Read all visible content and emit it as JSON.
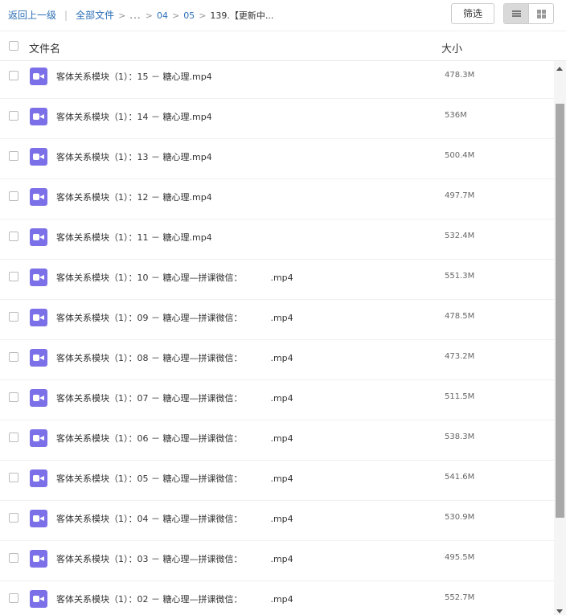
{
  "breadcrumb": {
    "back": "返回上一级",
    "separator": "|",
    "all_files": "全部文件",
    "ellipsis": "...",
    "level1": "04",
    "level2": "05",
    "current": "139.【更新中..."
  },
  "toolbar": {
    "filter_label": "筛选",
    "view_mode": "list"
  },
  "table": {
    "columns": {
      "name": "文件名",
      "size": "大小"
    },
    "rows": [
      {
        "name": "客体关系模块（1）：15 － 糖心理.mp4",
        "size": "478.3M",
        "icon": "video-file-icon"
      },
      {
        "name": "客体关系模块（1）：14 － 糖心理.mp4",
        "size": "536M",
        "icon": "video-file-icon"
      },
      {
        "name": "客体关系模块（1）：13 － 糖心理.mp4",
        "size": "500.4M",
        "icon": "video-file-icon"
      },
      {
        "name": "客体关系模块（1）：12 － 糖心理.mp4",
        "size": "497.7M",
        "icon": "video-file-icon"
      },
      {
        "name": "客体关系模块（1）：11 － 糖心理.mp4",
        "size": "532.4M",
        "icon": "video-file-icon"
      },
      {
        "name": "客体关系模块（1）：10 － 糖心理—拼课微信：          .mp4",
        "size": "551.3M",
        "icon": "video-file-icon"
      },
      {
        "name": "客体关系模块（1）：09 － 糖心理—拼课微信：          .mp4",
        "size": "478.5M",
        "icon": "video-file-icon"
      },
      {
        "name": "客体关系模块（1）：08 － 糖心理—拼课微信：          .mp4",
        "size": "473.2M",
        "icon": "video-file-icon"
      },
      {
        "name": "客体关系模块（1）：07 － 糖心理—拼课微信：          .mp4",
        "size": "511.5M",
        "icon": "video-file-icon"
      },
      {
        "name": "客体关系模块（1）：06 － 糖心理—拼课微信：          .mp4",
        "size": "538.3M",
        "icon": "video-file-icon"
      },
      {
        "name": "客体关系模块（1）：05 － 糖心理—拼课微信：          .mp4",
        "size": "541.6M",
        "icon": "video-file-icon"
      },
      {
        "name": "客体关系模块（1）：04 － 糖心理—拼课微信：          .mp4",
        "size": "530.9M",
        "icon": "video-file-icon"
      },
      {
        "name": "客体关系模块（1）：03 － 糖心理—拼课微信：          .mp4",
        "size": "495.5M",
        "icon": "video-file-icon"
      },
      {
        "name": "客体关系模块（1）：02 － 糖心理—拼课微信：          .mp4",
        "size": "552.7M",
        "icon": "video-file-icon"
      }
    ]
  },
  "colors": {
    "link": "#2c6fb7",
    "video_icon": "#7b70e8",
    "scroll_thumb": "#a8a8a8"
  }
}
